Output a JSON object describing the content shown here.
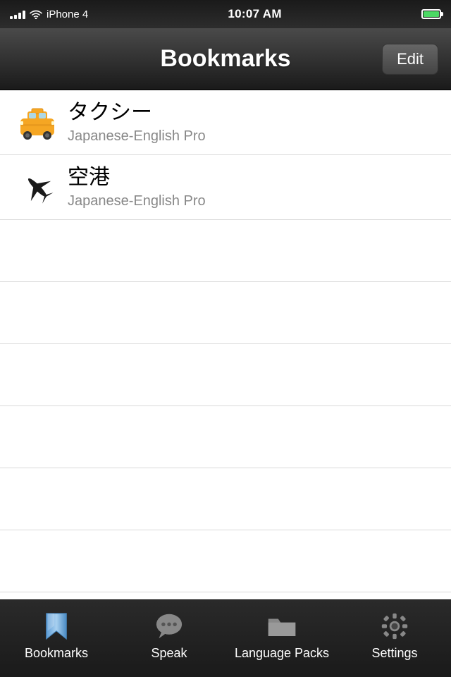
{
  "status_bar": {
    "carrier": "iPhone 4",
    "time": "10:07 AM",
    "battery_level": "100"
  },
  "nav_bar": {
    "title": "Bookmarks",
    "edit_button": "Edit"
  },
  "bookmarks": [
    {
      "id": 1,
      "icon_type": "taxi",
      "title": "タクシー",
      "subtitle": "Japanese-English Pro"
    },
    {
      "id": 2,
      "icon_type": "plane",
      "title": "空港",
      "subtitle": "Japanese-English Pro"
    }
  ],
  "empty_rows": 7,
  "tab_bar": {
    "items": [
      {
        "id": "bookmarks",
        "label": "Bookmarks",
        "icon": "bookmark",
        "active": true
      },
      {
        "id": "speak",
        "label": "Speak",
        "icon": "speech",
        "active": false
      },
      {
        "id": "language-packs",
        "label": "Language Packs",
        "icon": "folder",
        "active": false
      },
      {
        "id": "settings",
        "label": "Settings",
        "icon": "gear",
        "active": false
      }
    ]
  }
}
